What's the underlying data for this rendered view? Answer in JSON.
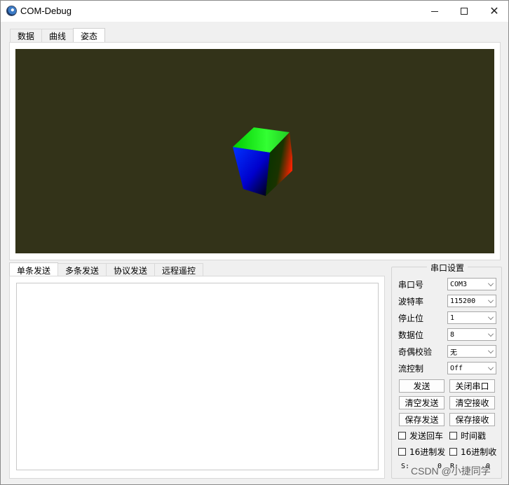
{
  "window": {
    "title": "COM-Debug"
  },
  "top_tabs": [
    {
      "label": "数据"
    },
    {
      "label": "曲线"
    },
    {
      "label": "姿态"
    }
  ],
  "view": {
    "background": "#333319",
    "object": "cube"
  },
  "bottom_tabs": [
    {
      "label": "单条发送"
    },
    {
      "label": "多条发送"
    },
    {
      "label": "协议发送"
    },
    {
      "label": "远程遥控"
    }
  ],
  "send_area": {
    "value": ""
  },
  "serial": {
    "title": "串口设置",
    "port_label": "串口号",
    "port_value": "COM3",
    "baud_label": "波特率",
    "baud_value": "115200",
    "stop_label": "停止位",
    "stop_value": "1",
    "data_label": "数据位",
    "data_value": "8",
    "parity_label": "奇偶校验",
    "parity_value": "无",
    "flow_label": "流控制",
    "flow_value": "Off"
  },
  "buttons": {
    "send": "发送",
    "close_port": "关闭串口",
    "clear_send": "清空发送",
    "clear_recv": "清空接收",
    "save_send": "保存发送",
    "save_recv": "保存接收"
  },
  "checks": {
    "send_newline": "发送回车",
    "timestamp": "时间戳",
    "hex_send": "16进制发",
    "hex_recv": "16进制收"
  },
  "counters": {
    "s_label": "S:",
    "s_value": "0",
    "r_label": "R:",
    "r_value": "0"
  },
  "watermark": "CSDN @小捷同学"
}
